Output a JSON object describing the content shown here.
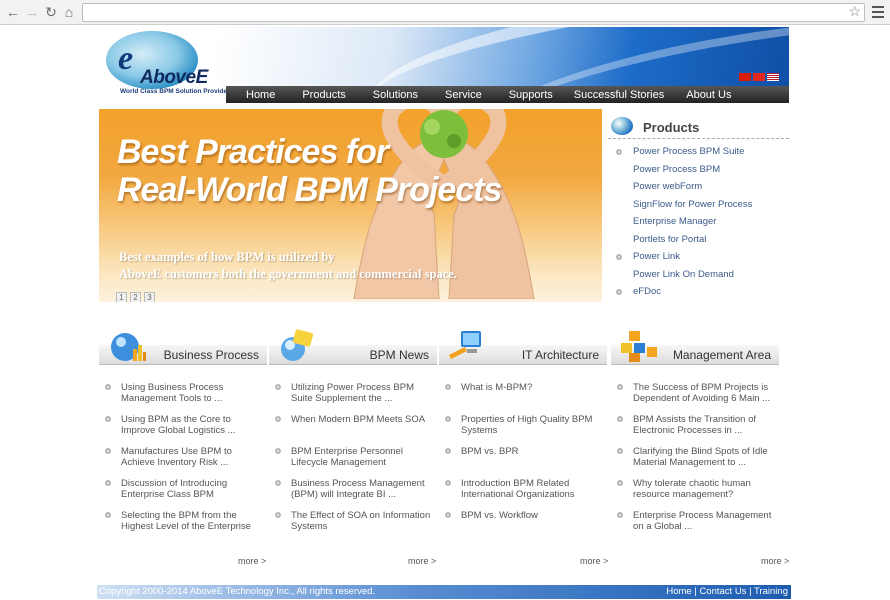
{
  "browser": {
    "back_glyph": "←",
    "forward_glyph": "→",
    "reload_glyph": "↻",
    "home_glyph": "⌂",
    "star_glyph": "☆",
    "url": ""
  },
  "logo": {
    "name": "AboveE",
    "tagline": "World Class BPM Solution Provider"
  },
  "nav": [
    "Home",
    "Products",
    "Solutions",
    "Service",
    "Supports",
    "Successful Stories",
    "About Us"
  ],
  "flags": [
    "#d81e06",
    "#d81e06",
    "#b22234"
  ],
  "hero": {
    "title_line1": "Best Practices for",
    "title_line2": "Real-World BPM Projects",
    "subtitle_line1": "Best examples of how BPM is utilized by",
    "subtitle_line2": "AboveE customers both the government and commercial space.",
    "slides": [
      "1",
      "2",
      "3"
    ]
  },
  "products": {
    "title": "Products",
    "items": [
      "Power Process BPM Suite",
      "Power Process BPM",
      "Power webForm",
      "SignFlow for Power Process",
      "Enterprise Manager",
      "Portlets for Portal",
      "Power Link",
      "Power Link On Demand",
      "eFDoc"
    ],
    "bulleted": [
      true,
      false,
      false,
      false,
      false,
      false,
      true,
      false,
      true
    ]
  },
  "columns": [
    {
      "title": "Business Process",
      "icon": "globe-chart-icon",
      "items": [
        "Using Business Process Management Tools to ...",
        "Using BPM as the Core to Improve Global Logistics ...",
        "Manufactures Use BPM to Achieve Inventory Risk ...",
        "Discussion of Introducing Enterprise Class BPM",
        "Selecting the BPM from the Highest Level of the Enterprise"
      ],
      "more": "more >"
    },
    {
      "title": "BPM News",
      "icon": "news-folder-icon",
      "items": [
        "Utilizing Power Process BPM Suite Supplement the ...",
        "When Modern BPM Meets SOA",
        "BPM Enterprise Personnel Lifecycle Management",
        "Business Process Management (BPM) will Integrate BI ...",
        "The Effect of SOA on Information Systems"
      ],
      "more": "more >"
    },
    {
      "title": "IT Architecture",
      "icon": "computer-tools-icon",
      "items": [
        "What is M-BPM?",
        "Properties of High Quality BPM Systems",
        "BPM vs. BPR",
        "Introduction BPM Related International Organizations",
        "BPM vs. Workflow"
      ],
      "more": "more >"
    },
    {
      "title": "Management Area",
      "icon": "cubes-icon",
      "items": [
        "The Success of BPM Projects is Dependent of Avoiding 6 Main ...",
        "BPM Assists the Transition of Electronic Processes in ...",
        "Clarifying the Blind Spots of Idle Material Management to ...",
        "Why tolerate chaotic human resource management?",
        "Enterprise Process Management on a Global ..."
      ],
      "more": "more >"
    }
  ],
  "footer": {
    "copyright": "Copyright 2000-2014 AboveE Technology Inc., All rights reserved.",
    "links": [
      "Home",
      "Contact Us",
      "Training"
    ],
    "separator": "|"
  }
}
